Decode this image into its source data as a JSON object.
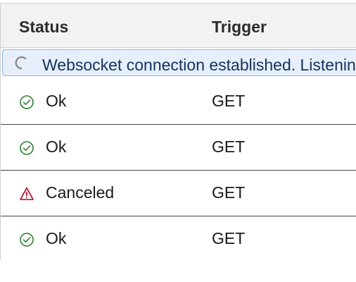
{
  "table": {
    "columns": {
      "status": "Status",
      "trigger": "Trigger"
    },
    "banner": {
      "text": "Websocket connection established. Listening for events...",
      "icon": "spinner-icon"
    },
    "rows": [
      {
        "status": "Ok",
        "status_icon": "check-circle-icon",
        "trigger": "GET"
      },
      {
        "status": "Ok",
        "status_icon": "check-circle-icon",
        "trigger": "GET"
      },
      {
        "status": "Canceled",
        "status_icon": "warning-triangle-icon",
        "trigger": "GET"
      },
      {
        "status": "Ok",
        "status_icon": "check-circle-icon",
        "trigger": "GET"
      }
    ]
  },
  "colors": {
    "ok": "#2e7d32",
    "warning": "#b00020",
    "banner_bg": "#e6effb",
    "banner_border": "#8fb0e6",
    "banner_text": "#16325c",
    "header_bg": "#f2f2f2"
  }
}
